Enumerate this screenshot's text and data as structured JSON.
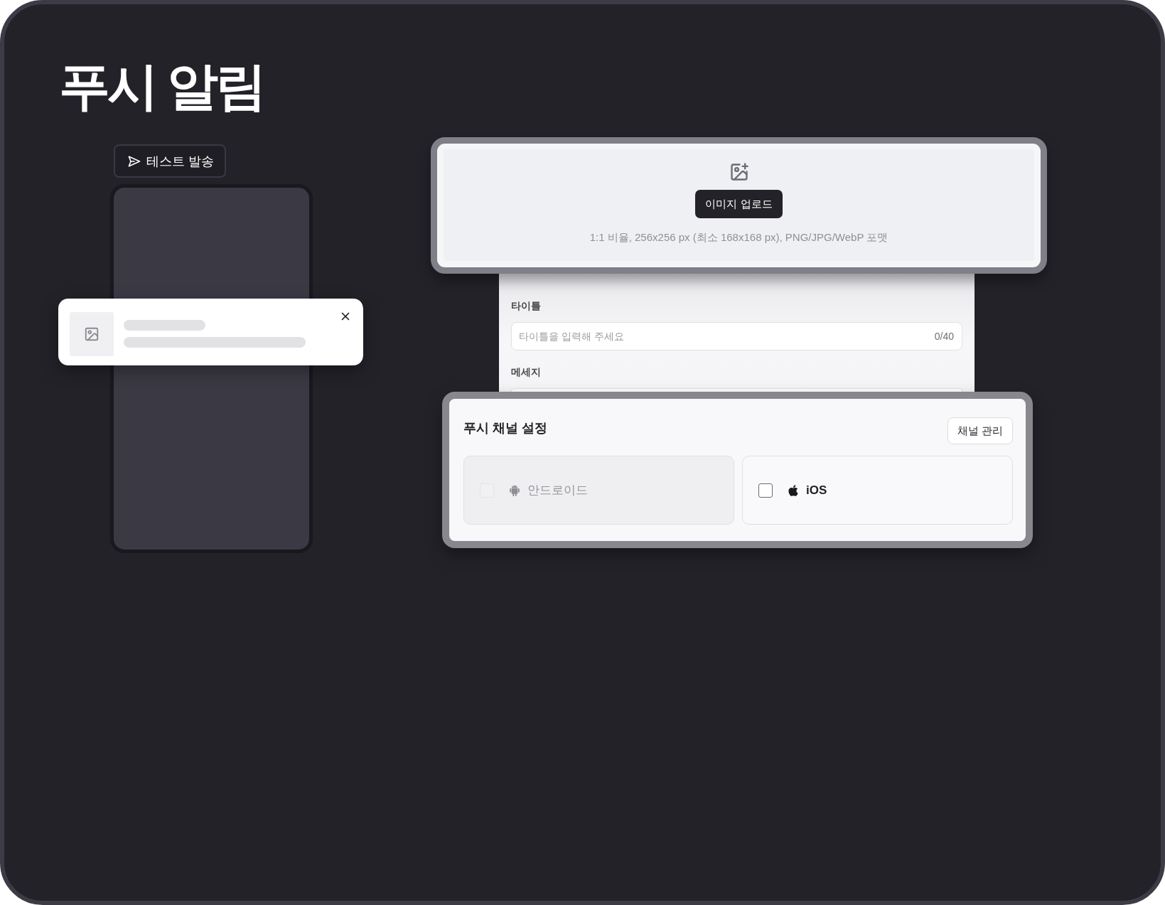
{
  "title": "푸시 알림",
  "test_button": {
    "label": "테스트 발송"
  },
  "upload": {
    "button": "이미지 업로드",
    "hint": "1:1 비율, 256x256 px (최소 168x168 px), PNG/JPG/WebP 포맷"
  },
  "form": {
    "fields": [
      {
        "label": "타이틀",
        "placeholder": "타이틀을 입력해 주세요",
        "counter": "0/40"
      },
      {
        "label": "메세지"
      }
    ]
  },
  "channel_settings": {
    "title": "푸시 채널 설정",
    "manage_button": "채널 관리",
    "channels": [
      {
        "kind": "android",
        "label": "안드로이드",
        "checked": false,
        "disabled": true
      },
      {
        "kind": "ios",
        "label": "iOS",
        "checked": false,
        "disabled": false
      }
    ]
  }
}
